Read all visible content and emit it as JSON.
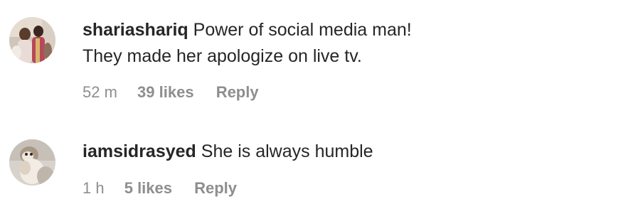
{
  "comments": [
    {
      "username": "shariashariq",
      "text_line1": "Power of social media man!",
      "text_line2": "They made her apologize on live tv.",
      "time": "52 m",
      "likes": "39 likes",
      "reply": "Reply",
      "avatar_icon": "user-avatar-photo-group"
    },
    {
      "username": "iamsidrasyed",
      "text_line1": "She is always humble",
      "time": "1 h",
      "likes": "5 likes",
      "reply": "Reply",
      "avatar_icon": "user-avatar-photo-pet"
    }
  ]
}
